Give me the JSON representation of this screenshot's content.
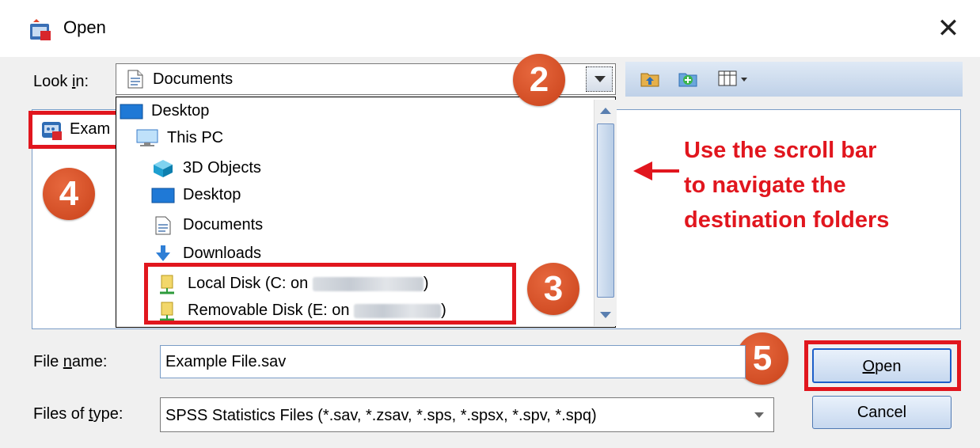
{
  "window": {
    "title": "Open",
    "close_glyph": "✕"
  },
  "look_in": {
    "label_prefix": "Look ",
    "label_accel": "i",
    "label_suffix": "n:",
    "value": "Documents"
  },
  "file_list": {
    "items": [
      {
        "label": "Exam"
      }
    ]
  },
  "dropdown": {
    "items": [
      {
        "label": "Desktop",
        "icon": "desktop-icon"
      },
      {
        "label": "This PC",
        "icon": "computer-icon"
      },
      {
        "label": "3D Objects",
        "icon": "cube-icon"
      },
      {
        "label": "Desktop",
        "icon": "desktop-icon"
      },
      {
        "label": "Documents",
        "icon": "document-icon"
      },
      {
        "label": "Downloads",
        "icon": "download-icon"
      },
      {
        "label_start": "Local Disk (C: on",
        "label_end": ")",
        "icon": "network-drive-icon"
      },
      {
        "label_start": "Removable Disk (E: on",
        "label_end": ")",
        "icon": "network-drive-icon"
      }
    ]
  },
  "annotations": {
    "step2": "2",
    "step3": "3",
    "step4": "4",
    "step5": "5",
    "note_line1": "Use the scroll bar",
    "note_line2": "to navigate the",
    "note_line3": "destination folders"
  },
  "file_name": {
    "label_prefix": "File ",
    "label_accel": "n",
    "label_suffix": "ame:",
    "value": "Example File.sav"
  },
  "file_type": {
    "label_prefix": "Files of ",
    "label_accel": "t",
    "label_suffix": "ype:",
    "value": "SPSS Statistics Files (*.sav, *.zsav, *.sps, *.spsx, *.spv, *.spq)"
  },
  "buttons": {
    "open_accel": "O",
    "open_rest": "pen",
    "cancel": "Cancel"
  },
  "colors": {
    "annotation_red": "#e1161e",
    "badge_orange": "#d3502a",
    "accent_blue": "#1d5fc9"
  }
}
